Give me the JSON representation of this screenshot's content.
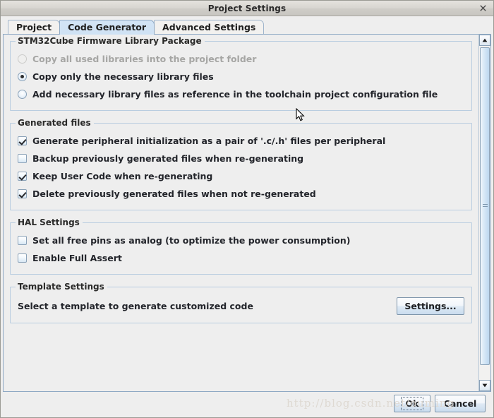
{
  "window": {
    "title": "Project Settings",
    "close_icon": "close-icon"
  },
  "tabs": [
    {
      "label": "Project",
      "selected": false
    },
    {
      "label": "Code Generator",
      "selected": true
    },
    {
      "label": "Advanced Settings",
      "selected": false
    }
  ],
  "groups": {
    "firmware": {
      "title": "STM32Cube Firmware Library Package",
      "options": [
        {
          "label": "Copy all used libraries into the project folder",
          "checked": false,
          "disabled": true
        },
        {
          "label": "Copy only the necessary library files",
          "checked": true,
          "disabled": false
        },
        {
          "label": "Add necessary library files as reference in the toolchain project configuration file",
          "checked": false,
          "disabled": false
        }
      ]
    },
    "generated_files": {
      "title": "Generated files",
      "options": [
        {
          "label": "Generate peripheral initialization as a pair of '.c/.h' files per peripheral",
          "checked": true
        },
        {
          "label": "Backup previously generated files when re-generating",
          "checked": false
        },
        {
          "label": "Keep User Code when re-generating",
          "checked": true
        },
        {
          "label": "Delete previously generated files when not re-generated",
          "checked": true
        }
      ]
    },
    "hal_settings": {
      "title": "HAL Settings",
      "options": [
        {
          "label": "Set all free pins as analog (to optimize the power consumption)",
          "checked": false
        },
        {
          "label": "Enable Full Assert",
          "checked": false
        }
      ]
    },
    "template_settings": {
      "title": "Template Settings",
      "description": "Select a template to generate customized code",
      "settings_button": "Settings..."
    }
  },
  "scrollbar": {
    "up_icon": "scroll-up-arrow-icon",
    "down_icon": "scroll-down-arrow-icon"
  },
  "footer": {
    "ok_label": "Ok",
    "cancel_label": "Cancel"
  },
  "watermark": "http://blog.csdn.net/ouming",
  "colors": {
    "accent": "#cfe2f4",
    "group_border": "#b9cde0",
    "window_bg": "#eeeeee"
  }
}
